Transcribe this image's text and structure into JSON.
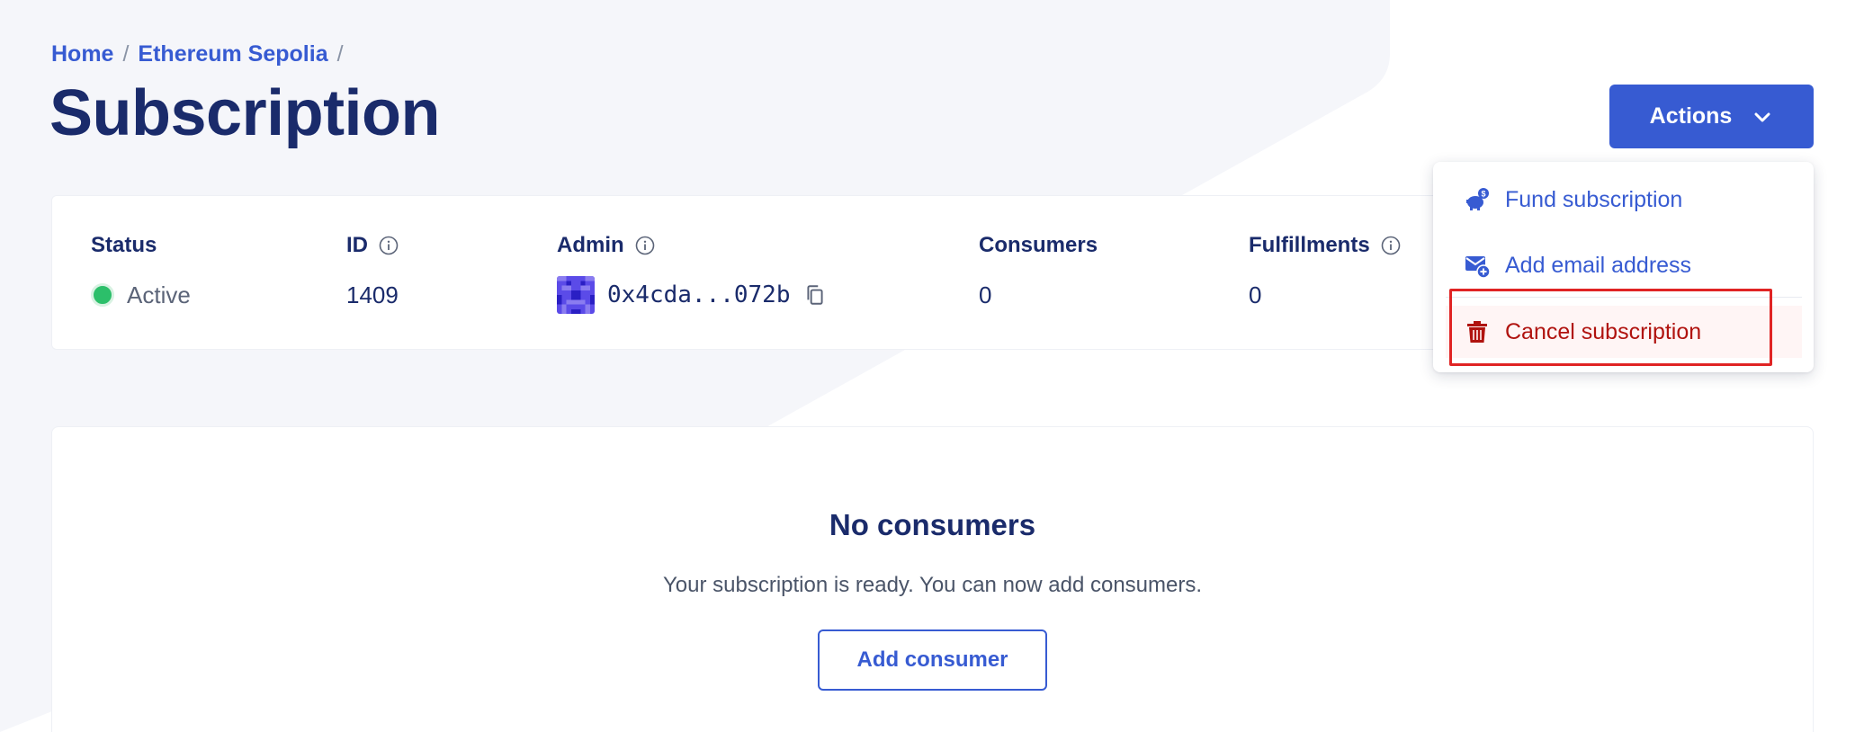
{
  "breadcrumb": {
    "items": [
      {
        "label": "Home"
      },
      {
        "label": "Ethereum Sepolia"
      }
    ],
    "separator": "/"
  },
  "page": {
    "title": "Subscription"
  },
  "actions": {
    "label": "Actions",
    "menu": [
      {
        "label": "Fund subscription",
        "icon": "piggy-bank-icon"
      },
      {
        "label": "Add email address",
        "icon": "add-email-icon"
      },
      {
        "label": "Cancel subscription",
        "icon": "trash-icon"
      }
    ]
  },
  "info": {
    "status": {
      "label": "Status",
      "value": "Active"
    },
    "id": {
      "label": "ID",
      "value": "1409"
    },
    "admin": {
      "label": "Admin",
      "value": "0x4cda...072b"
    },
    "consumers": {
      "label": "Consumers",
      "value": "0"
    },
    "fulfillments": {
      "label": "Fulfillments",
      "value": "0"
    }
  },
  "consumers_panel": {
    "title": "No consumers",
    "description": "Your subscription is ready. You can now add consumers.",
    "button_label": "Add consumer"
  },
  "colors": {
    "primary": "#375bd2",
    "heading": "#1a2b6b",
    "status_active": "#2cbf6a",
    "danger": "#b0130f",
    "highlight": "#e02424",
    "background_shape": "#f5f6fa"
  }
}
